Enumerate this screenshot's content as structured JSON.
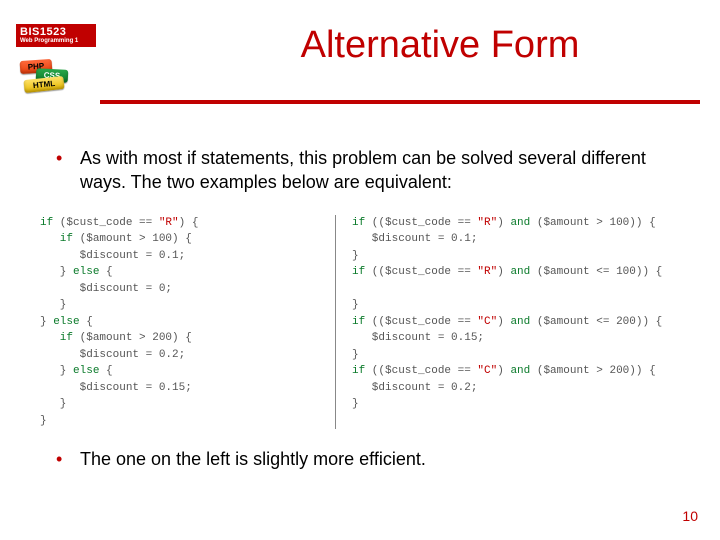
{
  "course": {
    "code": "BIS1523",
    "name": "Web Programming 1"
  },
  "lego": {
    "php": "PHP",
    "css": "CSS",
    "html": "HTML"
  },
  "title": "Alternative Form",
  "bullets": {
    "b1": "As with most if statements, this problem can be solved several different ways.  The two examples below are equivalent:",
    "b2": "The one on the left is slightly more efficient."
  },
  "code_left": [
    {
      "t": "if",
      "c": "kw"
    },
    {
      "t": " ($cust_code == ",
      "c": "op"
    },
    {
      "t": "\"R\"",
      "c": "str"
    },
    {
      "t": ") {\n",
      "c": "op"
    },
    {
      "t": "   if",
      "c": "kw"
    },
    {
      "t": " ($amount > 100) {\n",
      "c": "op"
    },
    {
      "t": "      $discount = 0.1;\n",
      "c": "op"
    },
    {
      "t": "   } ",
      "c": "op"
    },
    {
      "t": "else",
      "c": "kw"
    },
    {
      "t": " {\n",
      "c": "op"
    },
    {
      "t": "      $discount = 0;\n",
      "c": "op"
    },
    {
      "t": "   }\n",
      "c": "op"
    },
    {
      "t": "} ",
      "c": "op"
    },
    {
      "t": "else",
      "c": "kw"
    },
    {
      "t": " {\n",
      "c": "op"
    },
    {
      "t": "   if",
      "c": "kw"
    },
    {
      "t": " ($amount > 200) {\n",
      "c": "op"
    },
    {
      "t": "      $discount = 0.2;\n",
      "c": "op"
    },
    {
      "t": "   } ",
      "c": "op"
    },
    {
      "t": "else",
      "c": "kw"
    },
    {
      "t": " {\n",
      "c": "op"
    },
    {
      "t": "      $discount = 0.15;\n",
      "c": "op"
    },
    {
      "t": "   }\n",
      "c": "op"
    },
    {
      "t": "}\n",
      "c": "op"
    }
  ],
  "code_right": [
    {
      "t": "if",
      "c": "kw"
    },
    {
      "t": " (($cust_code == ",
      "c": "op"
    },
    {
      "t": "\"R\"",
      "c": "str"
    },
    {
      "t": ") ",
      "c": "op"
    },
    {
      "t": "and",
      "c": "kw"
    },
    {
      "t": " ($amount > 100)) {\n",
      "c": "op"
    },
    {
      "t": "   $discount = 0.1;\n",
      "c": "op"
    },
    {
      "t": "}\n",
      "c": "op"
    },
    {
      "t": "if",
      "c": "kw"
    },
    {
      "t": " (($cust_code == ",
      "c": "op"
    },
    {
      "t": "\"R\"",
      "c": "str"
    },
    {
      "t": ") ",
      "c": "op"
    },
    {
      "t": "and",
      "c": "kw"
    },
    {
      "t": " ($amount <= 100)) {\n",
      "c": "op"
    },
    {
      "t": "\n",
      "c": "op"
    },
    {
      "t": "}\n",
      "c": "op"
    },
    {
      "t": "if",
      "c": "kw"
    },
    {
      "t": " (($cust_code == ",
      "c": "op"
    },
    {
      "t": "\"C\"",
      "c": "str"
    },
    {
      "t": ") ",
      "c": "op"
    },
    {
      "t": "and",
      "c": "kw"
    },
    {
      "t": " ($amount <= 200)) {\n",
      "c": "op"
    },
    {
      "t": "   $discount = 0.15;\n",
      "c": "op"
    },
    {
      "t": "}\n",
      "c": "op"
    },
    {
      "t": "if",
      "c": "kw"
    },
    {
      "t": " (($cust_code == ",
      "c": "op"
    },
    {
      "t": "\"C\"",
      "c": "str"
    },
    {
      "t": ") ",
      "c": "op"
    },
    {
      "t": "and",
      "c": "kw"
    },
    {
      "t": " ($amount > 200)) {\n",
      "c": "op"
    },
    {
      "t": "   $discount = 0.2;\n",
      "c": "op"
    },
    {
      "t": "}\n",
      "c": "op"
    }
  ],
  "page_number": "10"
}
